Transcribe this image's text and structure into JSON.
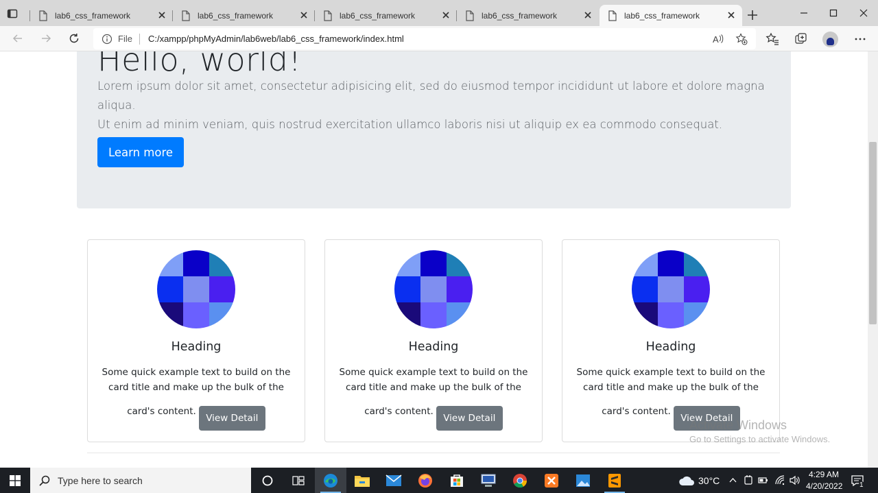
{
  "browser": {
    "tabs": [
      {
        "title": "lab6_css_framework",
        "active": false
      },
      {
        "title": "lab6_css_framework",
        "active": false
      },
      {
        "title": "lab6_css_framework",
        "active": false
      },
      {
        "title": "lab6_css_framework",
        "active": false
      },
      {
        "title": "lab6_css_framework",
        "active": true
      }
    ],
    "address": {
      "scheme_label": "File",
      "url": "C:/xampp/phpMyAdmin/lab6web/lab6_css_framework/index.html"
    }
  },
  "page": {
    "jumbotron": {
      "title": "Hello, world!",
      "lead_line1": "Lorem ipsum dolor sit amet, consectetur adipisicing elit, sed do eiusmod tempor incididunt ut labore et dolore magna aliqua.",
      "lead_line2": "Ut enim ad minim veniam, quis nostrud exercitation ullamco laboris nisi ut aliquip ex ea commodo consequat.",
      "button_label": "Learn more"
    },
    "cards": [
      {
        "heading": "Heading",
        "text_line1": "Some quick example text to build on the",
        "text_line2": "card title and make up the bulk of the",
        "text_line3": "card's content.",
        "button_label": "View Detail"
      },
      {
        "heading": "Heading",
        "text_line1": "Some quick example text to build on the",
        "text_line2": "card title and make up the bulk of the",
        "text_line3": "card's content.",
        "button_label": "View Detail"
      },
      {
        "heading": "Heading",
        "text_line1": "Some quick example text to build on the",
        "text_line2": "card title and make up the bulk of the",
        "text_line3": "card's content.",
        "button_label": "View Detail"
      }
    ],
    "card_image_colors": [
      "#7f9ff7",
      "#0a00c8",
      "#1f7fb6",
      "#0a2ff0",
      "#7f8ef0",
      "#4a1ff0",
      "#1a0a7a",
      "#6a60ff",
      "#5a90f0"
    ],
    "accent_color": "#007bff"
  },
  "watermark": {
    "line1": "Activate Windows",
    "line2": "Go to Settings to activate Windows."
  },
  "taskbar": {
    "search_placeholder": "Type here to search",
    "weather": "30°C",
    "time": "4:29 AM",
    "date": "4/20/2022",
    "notification_count": "1"
  }
}
